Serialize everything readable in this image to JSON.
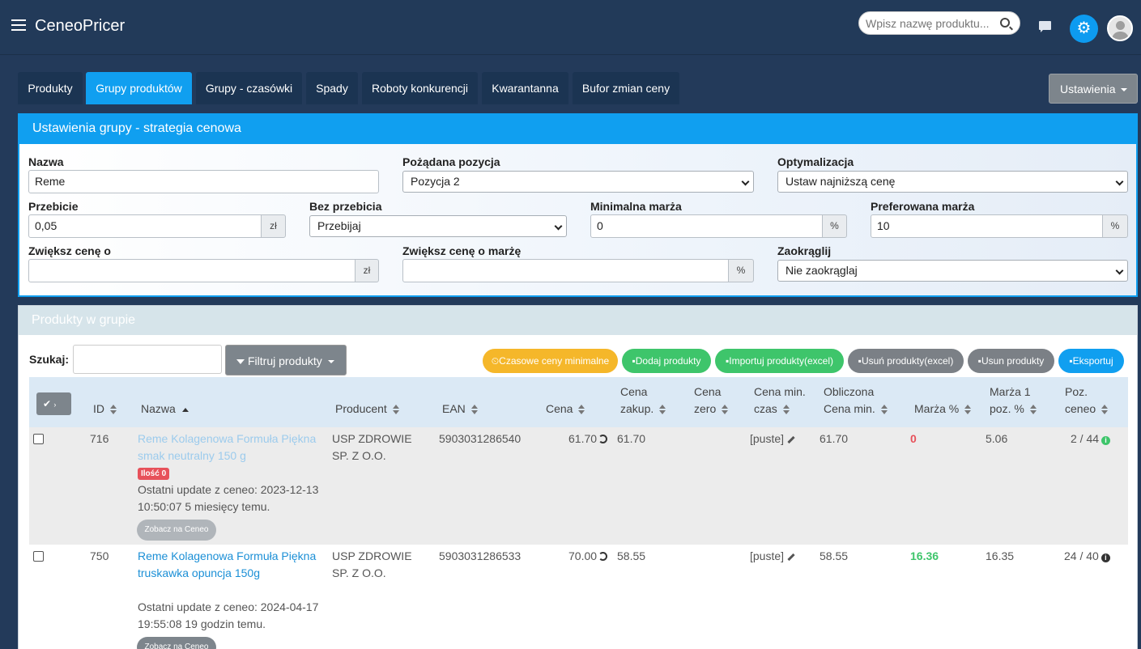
{
  "app": {
    "title": "CeneoPricer"
  },
  "header": {
    "search_placeholder": "Wpisz nazwę produktu..."
  },
  "tabs": [
    "Produkty",
    "Grupy produktów",
    "Grupy - czasówki",
    "Spady",
    "Roboty konkurencji",
    "Kwarantanna",
    "Bufor zmian ceny"
  ],
  "settings_label": "Ustawienia",
  "group_settings": {
    "title": "Ustawienia grupy - strategia cenowa",
    "nazwa_label": "Nazwa",
    "nazwa_value": "Reme",
    "pozycja_label": "Pożądana pozycja",
    "pozycja_value": "Pozycja 2",
    "optymalizacja_label": "Optymalizacja",
    "optymalizacja_value": "Ustaw najniższą cenę",
    "przebicie_label": "Przebicie",
    "przebicie_value": "0,05",
    "przebicie_unit": "zł",
    "bez_przebicia_label": "Bez przebicia",
    "bez_przebicia_value": "Przebijaj",
    "min_marza_label": "Minimalna marża",
    "min_marza_value": "0",
    "min_marza_unit": "%",
    "pref_marza_label": "Preferowana marża",
    "pref_marza_value": "10",
    "pref_marza_unit": "%",
    "zwieksz_label": "Zwiększ cenę o",
    "zwieksz_unit": "zł",
    "zwieksz_marza_label": "Zwiększ cenę o marżę",
    "zwieksz_marza_unit": "%",
    "zaokraglij_label": "Zaokrąglij",
    "zaokraglij_value": "Nie zaokrąglaj"
  },
  "products": {
    "title": "Produkty w grupie",
    "search_label": "Szukaj:",
    "filter_label": "Filtruj produkty",
    "actions": [
      "Czasowe ceny minimalne",
      "Dodaj produkty",
      "Importuj produkty(excel)",
      "Usuń produkty(excel)",
      "Usun produkty",
      "Eksportuj"
    ],
    "columns": {
      "id": "ID",
      "nazwa": "Nazwa",
      "producent": "Producent",
      "ean": "EAN",
      "cena": "Cena",
      "cena_zakup_1": "Cena",
      "cena_zakup_2": "zakup.",
      "cena_zero_1": "Cena",
      "cena_zero_2": "zero",
      "cena_min_1": "Cena min.",
      "cena_min_2": "czas",
      "obliczona_1": "Obliczona",
      "obliczona_2": "Cena min.",
      "marza": "Marża %",
      "marza1_1": "Marża 1",
      "marza1_2": "poz. %",
      "poz_1": "Poz.",
      "poz_2": "ceneo"
    },
    "rows": [
      {
        "id": "716",
        "name_line1": "Reme Kolagenowa Formuła Piękna",
        "name_line2": "smak neutralny 150 g",
        "badge": "Ilość 0",
        "update_line1": "Ostatni update z ceneo: 2023-12-13",
        "update_line2": "10:50:07 5 miesięcy temu.",
        "ceneo_btn": "Zobacz na Ceneo",
        "producer_line1": "USP ZDROWIE",
        "producer_line2": "SP. Z O.O.",
        "ean": "5903031286540",
        "cena": "61.70",
        "cena_zakup": "61.70",
        "cena_min_czas": "[puste]",
        "obliczona": "61.70",
        "marza": "0",
        "marza1": "5.06",
        "poz": "2 / 44"
      },
      {
        "id": "750",
        "name_line1": "Reme Kolagenowa Formuła Piękna",
        "name_line2": "truskawka opuncja 150g",
        "update_line1": "Ostatni update z ceneo: 2024-04-17",
        "update_line2": "19:55:08 19 godzin temu.",
        "ceneo_btn": "Zobacz na Ceneo",
        "producer_line1": "USP ZDROWIE",
        "producer_line2": "SP. Z O.O.",
        "ean": "5903031286533",
        "cena": "70.00",
        "cena_zakup": "58.55",
        "cena_min_czas": "[puste]",
        "obliczona": "58.55",
        "marza": "16.36",
        "marza1": "16.35",
        "poz": "24 / 40"
      }
    ]
  }
}
